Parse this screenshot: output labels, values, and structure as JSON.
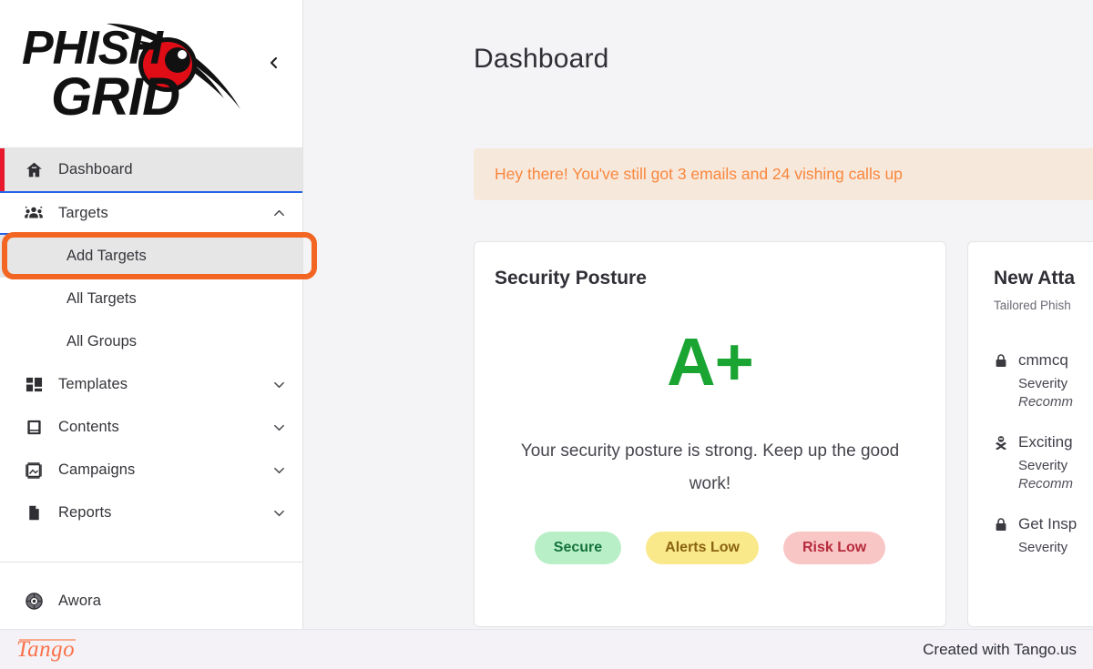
{
  "brand": {
    "logo_line1": "PHISH",
    "logo_line2": "GRID",
    "logo_alt": "PhishGrid logo with red eye",
    "eye_color": "#e00d17"
  },
  "sidebar": {
    "collapse_icon": "chevron-left-icon",
    "active_accent_color": "#e8192c",
    "focus_ring_color": "#2563eb",
    "items": [
      {
        "label": "Dashboard",
        "icon": "home-icon",
        "state": "active",
        "expandable": false
      },
      {
        "label": "Targets",
        "icon": "users-group-icon",
        "state": "expanded-focused",
        "expandable": true,
        "chevron": "chevron-up-icon"
      },
      {
        "label": "Templates",
        "icon": "grid-blocks-icon",
        "state": "collapsed",
        "expandable": true,
        "chevron": "chevron-down-icon"
      },
      {
        "label": "Contents",
        "icon": "book-icon",
        "state": "collapsed",
        "expandable": true,
        "chevron": "chevron-down-icon"
      },
      {
        "label": "Campaigns",
        "icon": "crop-frame-icon",
        "state": "collapsed",
        "expandable": true,
        "chevron": "chevron-down-icon"
      },
      {
        "label": "Reports",
        "icon": "file-document-icon",
        "state": "collapsed",
        "expandable": true,
        "chevron": "chevron-down-icon"
      }
    ],
    "targets_submenu": [
      {
        "label": "Add Targets",
        "state": "highlighted"
      },
      {
        "label": "All Targets",
        "state": "default"
      },
      {
        "label": "All Groups",
        "state": "default"
      }
    ],
    "account": {
      "label": "Awora",
      "icon": "globe-avatar-icon"
    }
  },
  "highlight": {
    "target": "Add Targets",
    "color": "#f26522",
    "shape": "rounded-rectangle"
  },
  "main": {
    "page_title": "Dashboard",
    "alert": {
      "text": "Hey there! You've still got 3 emails and 24 vishing calls up",
      "background": "#f7e8dc",
      "text_color": "#f9873d"
    },
    "cards": [
      {
        "id": "security-posture",
        "title": "Security Posture",
        "grade": "A+",
        "grade_color": "#1aa432",
        "description": "Your security posture is strong. Keep up the good work!",
        "badges": [
          {
            "label": "Secure",
            "bg": "#b9efc7",
            "fg": "#14743a"
          },
          {
            "label": "Alerts Low",
            "bg": "#fae98a",
            "fg": "#8a6312"
          },
          {
            "label": "Risk Low",
            "bg": "#f9c6c6",
            "fg": "#b62b3c"
          }
        ]
      },
      {
        "id": "new-attacks",
        "title": "New Atta",
        "subtitle": "Tailored Phish",
        "items": [
          {
            "icon": "lock-icon",
            "name": "cmmcq",
            "severity": "Severity",
            "recommendation": "Recomm"
          },
          {
            "icon": "skull-icon",
            "name": "Exciting",
            "severity": "Severity",
            "recommendation": "Recomm"
          },
          {
            "icon": "lock-icon",
            "name": "Get Insp",
            "severity": "Severity",
            "recommendation": ""
          }
        ]
      }
    ]
  },
  "footer": {
    "logo_text": "Tango",
    "credit": "Created with Tango.us"
  }
}
